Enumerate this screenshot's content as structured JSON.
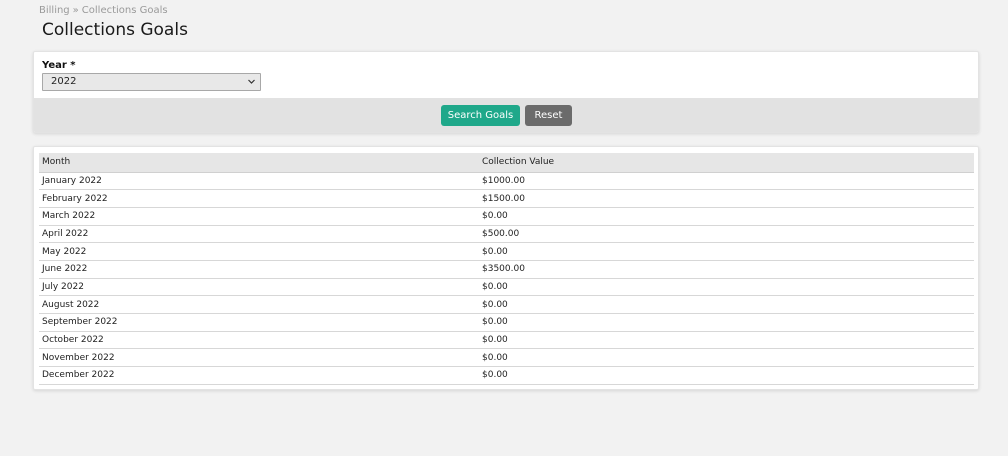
{
  "breadcrumb": {
    "parent": "Billing",
    "separator": "»",
    "current": "Collections Goals"
  },
  "page": {
    "title": "Collections Goals"
  },
  "search": {
    "year_label": "Year *",
    "year_value": "2022",
    "search_button": "Search Goals",
    "reset_button": "Reset"
  },
  "table": {
    "headers": {
      "month": "Month",
      "value": "Collection Value"
    },
    "rows": [
      {
        "month": "January 2022",
        "value": "$1000.00"
      },
      {
        "month": "February 2022",
        "value": "$1500.00"
      },
      {
        "month": "March 2022",
        "value": "$0.00"
      },
      {
        "month": "April 2022",
        "value": "$500.00"
      },
      {
        "month": "May 2022",
        "value": "$0.00"
      },
      {
        "month": "June 2022",
        "value": "$3500.00"
      },
      {
        "month": "July 2022",
        "value": "$0.00"
      },
      {
        "month": "August 2022",
        "value": "$0.00"
      },
      {
        "month": "September 2022",
        "value": "$0.00"
      },
      {
        "month": "October 2022",
        "value": "$0.00"
      },
      {
        "month": "November 2022",
        "value": "$0.00"
      },
      {
        "month": "December 2022",
        "value": "$0.00"
      }
    ]
  },
  "colors": {
    "primary_button": "#1fa88a",
    "secondary_button": "#6b6b6b",
    "page_background": "#f2f2f2"
  },
  "icons": {
    "select_arrow": "chevron-down-icon"
  }
}
